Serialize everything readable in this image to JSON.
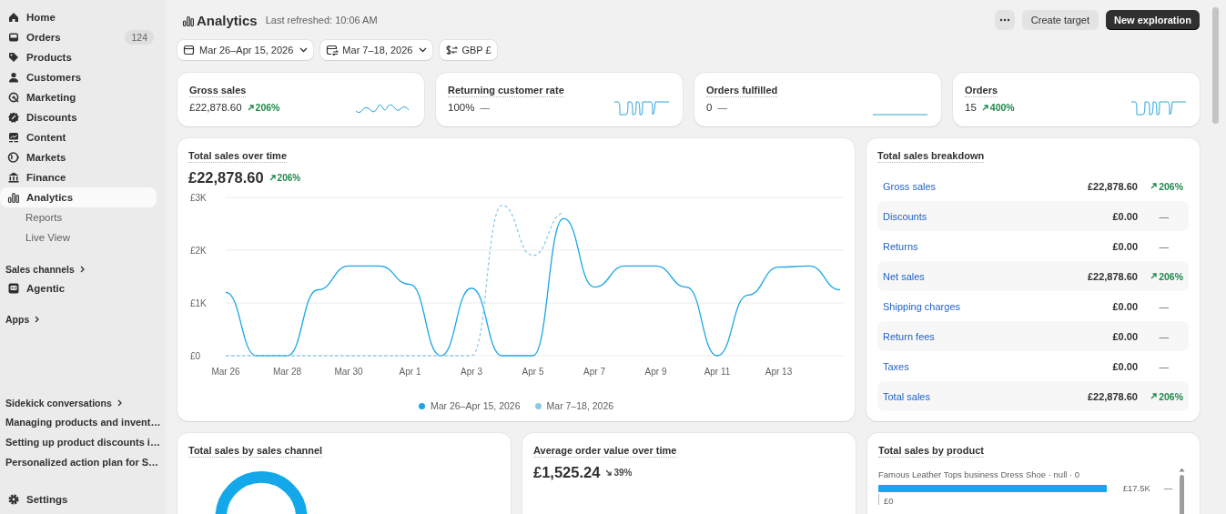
{
  "sidebar": {
    "nav": [
      {
        "label": "Home",
        "selected": false
      },
      {
        "label": "Orders",
        "badge": "124",
        "selected": false
      },
      {
        "label": "Products",
        "selected": false
      },
      {
        "label": "Customers",
        "selected": false
      },
      {
        "label": "Marketing",
        "selected": false
      },
      {
        "label": "Discounts",
        "selected": false
      },
      {
        "label": "Content",
        "selected": false
      },
      {
        "label": "Markets",
        "selected": false
      },
      {
        "label": "Finance",
        "selected": false
      },
      {
        "label": "Analytics",
        "selected": true,
        "children": [
          {
            "label": "Reports",
            "selected": false
          },
          {
            "label": "Live View",
            "selected": false
          }
        ]
      }
    ],
    "sales_channels": {
      "label": "Sales channels",
      "items": [
        {
          "label": "Agentic",
          "selected": false
        }
      ]
    },
    "apps": {
      "label": "Apps"
    },
    "sidekick": {
      "label": "Sidekick conversations",
      "items": [
        "Managing products and invent…",
        "Setting up product discounts i…",
        "Personalized action plan for S…"
      ]
    },
    "settings": {
      "label": "Settings"
    }
  },
  "header": {
    "title": "Analytics",
    "subtitle": "Last refreshed: 10:06 AM",
    "buttons": [
      {
        "kind": "more"
      },
      {
        "kind": "secondary",
        "label": "Create target"
      },
      {
        "kind": "primary",
        "label": "New exploration"
      }
    ]
  },
  "filters": [
    {
      "kind": "date",
      "label": "Mar 26–Apr 15, 2026"
    },
    {
      "kind": "compare",
      "label": "Mar 7–18, 2026"
    },
    {
      "kind": "currency",
      "label": "GBP £"
    }
  ],
  "kpis": [
    {
      "title": "Gross sales",
      "value": "£22,878.60",
      "change": {
        "kind": "up",
        "text": "206%"
      }
    },
    {
      "title": "Returning customer rate",
      "value": "100%",
      "change": {
        "kind": "none",
        "text": "—"
      }
    },
    {
      "title": "Orders fulfilled",
      "value": "0",
      "change": {
        "kind": "none",
        "text": "—"
      }
    },
    {
      "title": "Orders",
      "value": "15",
      "change": {
        "kind": "up",
        "text": "400%"
      }
    }
  ],
  "sales_over_time": {
    "title": "Total sales over time",
    "value": "£22,878.60",
    "change": {
      "kind": "up",
      "text": "206%"
    },
    "chart_data": {
      "type": "line",
      "categories": [
        "Mar 26",
        null,
        "Mar 28",
        null,
        "Mar 30",
        null,
        "Apr 1",
        null,
        "Apr 3",
        null,
        "Apr 5",
        null,
        "Apr 7",
        null,
        "Apr 9",
        null,
        "Apr 11",
        null,
        "Apr 13",
        null,
        null
      ],
      "ylim": [
        0,
        3000
      ],
      "legend": true,
      "yticks": [
        {
          "value": 0,
          "label": "£0"
        },
        {
          "value": 1000,
          "label": "£1K"
        },
        {
          "value": 2000,
          "label": "£2K"
        },
        {
          "value": 3000,
          "label": "£3K"
        }
      ],
      "series": [
        {
          "name": "Mar 26–Apr 15, 2026",
          "color": "#1ba6e6",
          "line_style": "solid",
          "values": [
            1200,
            0,
            0,
            1250,
            1700,
            1700,
            1350,
            0,
            1280,
            0,
            0,
            2600,
            1300,
            1700,
            1700,
            1300,
            0,
            1150,
            1680,
            1700,
            1250
          ]
        },
        {
          "name": "Mar 7–18, 2026",
          "color": "#8ccbe8",
          "line_style": "dashed",
          "values": [
            0,
            0,
            0,
            0,
            0,
            0,
            0,
            0,
            0,
            2850,
            1900,
            2700,
            null,
            null,
            null,
            null,
            null,
            null,
            null,
            null,
            null
          ]
        }
      ]
    }
  },
  "breakdown": {
    "title": "Total sales breakdown",
    "rows": [
      {
        "label": "Gross sales",
        "value": "£22,878.60",
        "change": {
          "kind": "up",
          "text": "206%"
        }
      },
      {
        "label": "Discounts",
        "value": "£0.00",
        "change": {
          "kind": "none",
          "text": "—"
        }
      },
      {
        "label": "Returns",
        "value": "£0.00",
        "change": {
          "kind": "none",
          "text": "—"
        }
      },
      {
        "label": "Net sales",
        "value": "£22,878.60",
        "change": {
          "kind": "up",
          "text": "206%"
        }
      },
      {
        "label": "Shipping charges",
        "value": "£0.00",
        "change": {
          "kind": "none",
          "text": "—"
        }
      },
      {
        "label": "Return fees",
        "value": "£0.00",
        "change": {
          "kind": "none",
          "text": "—"
        }
      },
      {
        "label": "Taxes",
        "value": "£0.00",
        "change": {
          "kind": "none",
          "text": "—"
        }
      },
      {
        "label": "Total sales",
        "value": "£22,878.60",
        "change": {
          "kind": "up",
          "text": "206%"
        }
      }
    ]
  },
  "sales_by_channel": {
    "title": "Total sales by sales channel"
  },
  "avg_order_value": {
    "title": "Average order value over time",
    "value": "£1,525.24",
    "change": {
      "kind": "down",
      "text": "39%"
    }
  },
  "sales_by_product": {
    "title": "Total sales by product",
    "comparisons": [
      "—"
    ],
    "chart_data": {
      "type": "bar",
      "orientation": "horizontal",
      "categories": [
        "Famous Leather Tops business Dress Shoe · null · 0"
      ],
      "values": [
        17500
      ],
      "value_labels": [
        "£17.5K"
      ],
      "annotations": [
        "£0"
      ]
    }
  }
}
